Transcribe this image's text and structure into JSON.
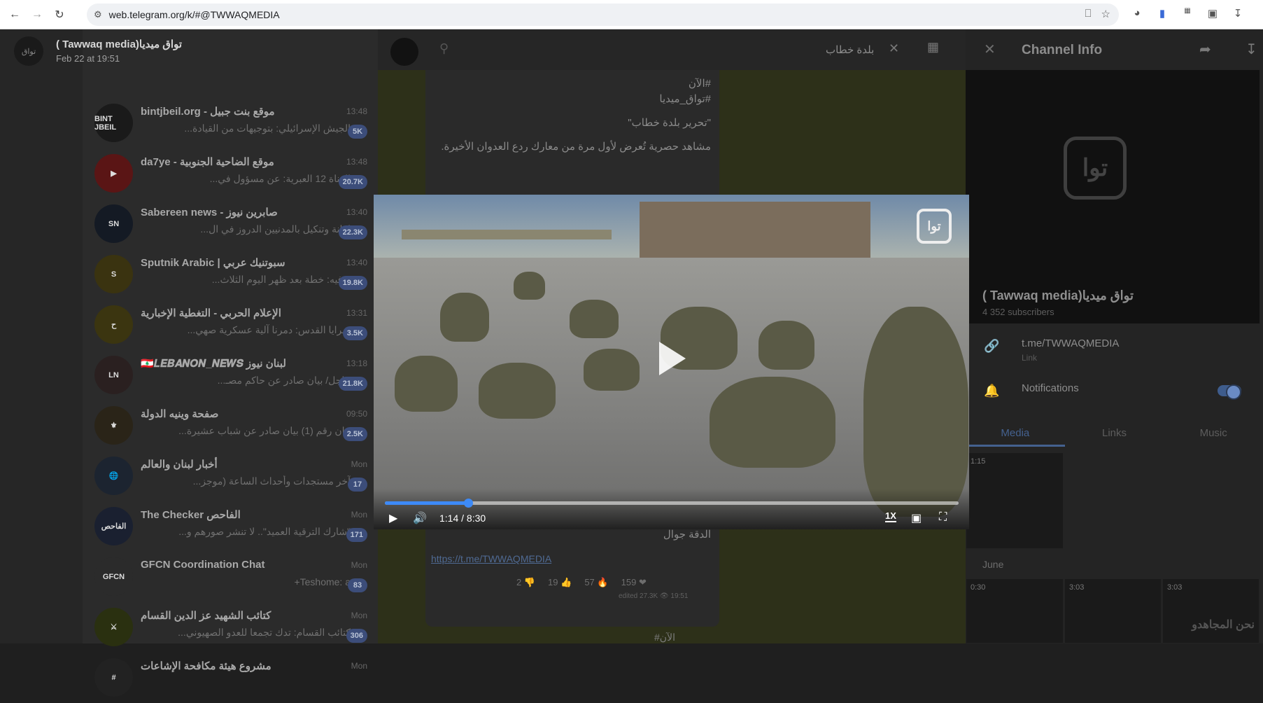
{
  "browser": {
    "url": "web.telegram.org/k/#@TWWAQMEDIA",
    "nav_icons": [
      "back-icon",
      "forward-icon",
      "reload-icon"
    ]
  },
  "media_viewer": {
    "channel_name": "( Tawwaq media)تواق ميديا",
    "date": "Feb 22 at 19:51",
    "time_display": "1:14 / 8:30",
    "speed": "1X",
    "progress_fraction": 0.1451,
    "watermark": "توا"
  },
  "chat_list": [
    {
      "name": "bintjbeil.org - موقع بنت جبيل",
      "time": "13:48",
      "preview": "الجيش الإسرائيلي: بتوجيهات من القيادة...",
      "badge": "5K",
      "avatar_color": "#1a1a1a",
      "avatar_text": "BINT JBEIL"
    },
    {
      "name": "da7ye - موقع الضاحية الجنوبية",
      "time": "13:48",
      "preview": "القناة 12 العبرية: عن مسؤول في...",
      "badge": "20.7K",
      "avatar_color": "#5a1515",
      "avatar_text": "▶"
    },
    {
      "name": "Sabereen news - صابرين نيوز",
      "time": "13:40",
      "preview": "إهانة وتنكيل بالمدنيين الدروز في ال...",
      "badge": "22.3K",
      "avatar_color": "#141a24",
      "avatar_text": "SN"
    },
    {
      "name": "Sputnik Arabic | سبوتنيك عربي",
      "time": "13:40",
      "preview": "ترفيه: خطة بعد ظهر اليوم الثلاث...",
      "badge": "19.8K",
      "avatar_color": "#3a3310",
      "avatar_text": "S"
    },
    {
      "name": "الإعلام الحربي - التغطية الإخبارية",
      "time": "13:31",
      "preview": "سرايا القدس: دمرنا آلية عسكرية صهي...",
      "badge": "3.5K",
      "avatar_color": "#3b3510",
      "avatar_text": "ح"
    },
    {
      "name": "🇱🇧𝑳𝑬𝑩𝑨𝑵𝑶𝑵_𝑵𝑬𝑾𝑺 لبنان نيوز",
      "time": "13:18",
      "preview": "عاجل/ بيان صادر عن حاكم مصـ...",
      "badge": "21.8K",
      "avatar_color": "#2a2020",
      "avatar_text": "LN"
    },
    {
      "name": "صفحة وينيه الدولة",
      "time": "09:50",
      "preview": "بيان رقم (1) بيان صادر عن شباب عشيرة...",
      "badge": "2.5K",
      "avatar_color": "#2a2418",
      "avatar_text": "⚜"
    },
    {
      "name": "أخبار لبنان والعالم",
      "time": "Mon",
      "preview": "آخر مستجدات وأحداث الساعة (موجز...",
      "badge": "17",
      "avatar_color": "#1c2430",
      "avatar_text": "🌐"
    },
    {
      "name": "The Checker الفاحص",
      "time": "Mon",
      "preview": "\"شارك الترقية العميد\".. لا تنشر صورهم و...",
      "badge": "171",
      "avatar_color": "#1a2030",
      "avatar_text": "الفاحص"
    },
    {
      "name": "GFCN Coordination Chat",
      "time": "Mon",
      "preview": "Teshome: a+",
      "badge": "83",
      "avatar_color": "#2b2b2b",
      "avatar_text": "GFCN"
    },
    {
      "name": "كتائب الشهيد عز الدين القسام",
      "time": "Mon",
      "preview": "كتائب القسام: تدك تجمعا للعدو الصهيوني...",
      "badge": "306",
      "avatar_color": "#2a3010",
      "avatar_text": "⚔"
    },
    {
      "name": "مشروع هيئة مكافحة الإشاعات",
      "time": "Mon",
      "preview": "",
      "badge": "",
      "avatar_color": "#222",
      "avatar_text": "#"
    }
  ],
  "chat": {
    "search_query": "بلدة خطاب",
    "message_lines": [
      "#الآن",
      "#تواق_ميديا",
      "\"تحرير بلدة خطاب\"",
      "مشاهد حصرية تُعرض لأول مرة من معارك ردع العدوان الأخيرة."
    ],
    "quality_line": "الدقة جوال",
    "link": "https://t.me/TWWAQMEDIA",
    "reactions": [
      {
        "emoji": "👎",
        "count": "2"
      },
      {
        "emoji": "👍",
        "count": "19"
      },
      {
        "emoji": "🔥",
        "count": "57"
      },
      {
        "emoji": "❤",
        "count": "159"
      }
    ],
    "views": "edited 27.3K 👁 19:51",
    "next_hashtag": "#الآن"
  },
  "info_panel": {
    "title": "Channel Info",
    "channel_name": "( Tawwaq media)تواق ميديا",
    "subscribers": "4 352 subscribers",
    "link": "t.me/TWWAQMEDIA",
    "link_label": "Link",
    "notifications_label": "Notifications",
    "tabs": [
      "Media",
      "Links",
      "Music"
    ],
    "month": "June",
    "thumb_durations": [
      "1:15",
      "0:30",
      "3:03",
      "3:03"
    ],
    "thumb_caption": "نحن المجاهدو"
  }
}
